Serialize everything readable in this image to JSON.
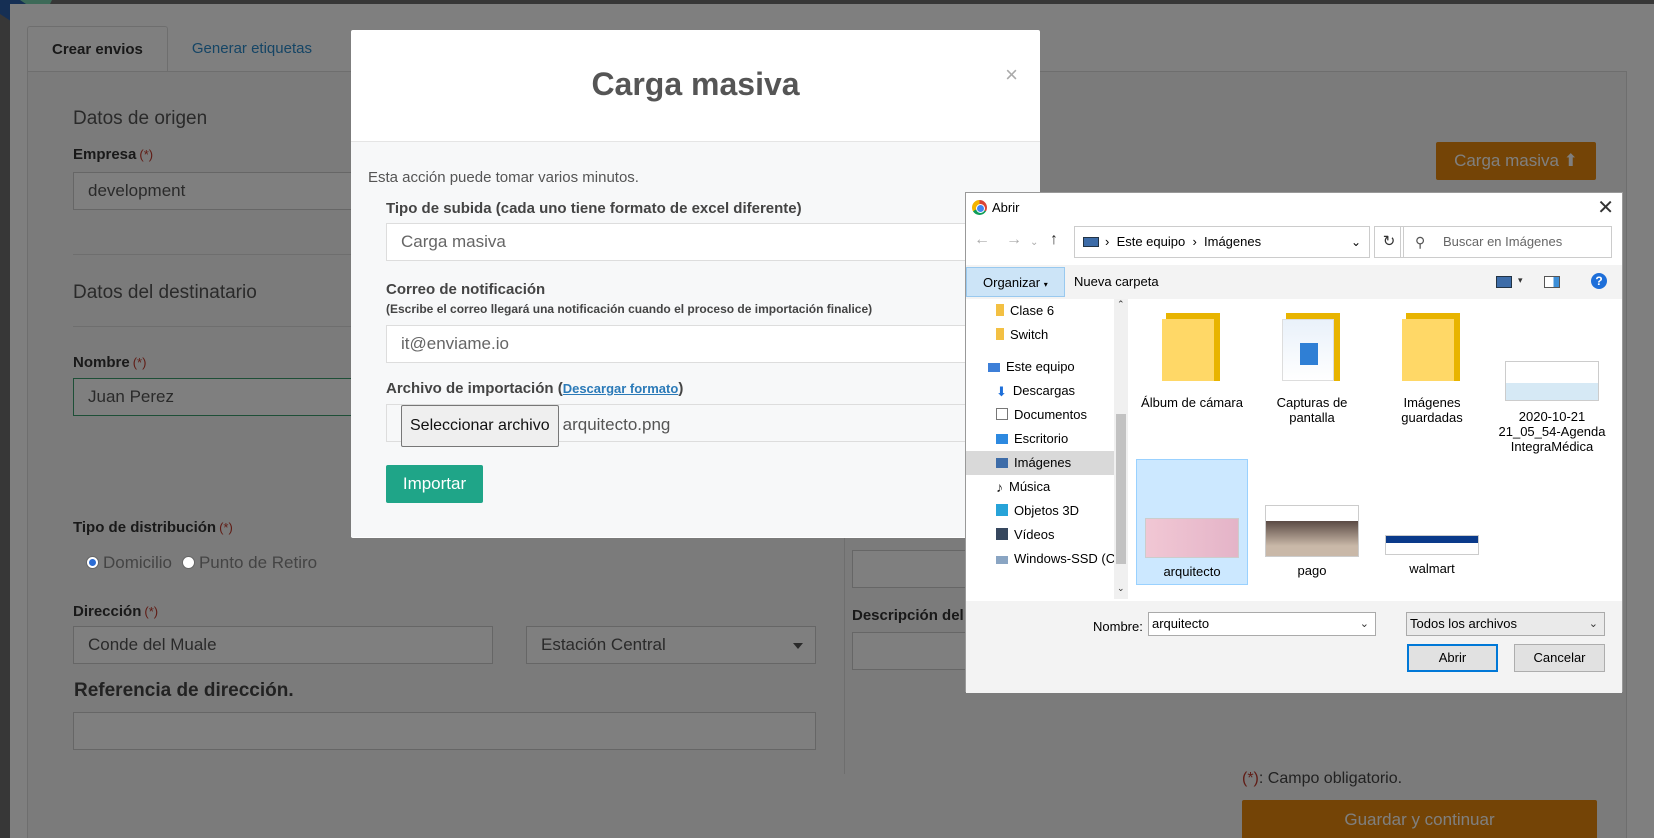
{
  "page": {
    "tabs": [
      "Crear envios",
      "Generar etiquetas"
    ],
    "origin": {
      "title": "Datos de origen",
      "empresa_label": "Empresa",
      "required_mark": "(*)",
      "empresa_value": "development"
    },
    "recipient": {
      "title": "Datos del destinatario",
      "nombre_label": "Nombre",
      "nombre_value": "Juan Perez"
    },
    "distribution": {
      "label": "Tipo de distribución",
      "options": [
        "Domicilio",
        "Punto de Retiro"
      ],
      "selected": "Domicilio"
    },
    "address": {
      "label": "Dirección",
      "value": "Conde del Muale",
      "commune": "Estación Central",
      "reference_label": "Referencia de dirección."
    },
    "description_label": "Descripción del",
    "carga_masiva_button": "Carga masiva",
    "required_note": ": Campo obligatorio.",
    "save_button": "Guardar y continuar"
  },
  "modal": {
    "title": "Carga masiva",
    "close": "×",
    "note": "Esta acción puede tomar varios minutos.",
    "upload_type_label": "Tipo de subida (cada uno tiene formato de excel diferente)",
    "upload_type_value": "Carga masiva",
    "email_label": "Correo de notificación",
    "email_help": "(Escribe el correo llegará una notificación cuando el proceso de importación finalice)",
    "email_value": "it@enviame.io",
    "file_label": "Archivo de importación",
    "file_link": "Descargar formato",
    "file_button": "Seleccionar archivo",
    "file_name": "arquitecto.png",
    "import_button": "Importar"
  },
  "dialog": {
    "title": "Abrir",
    "breadcrumb": [
      "Este equipo",
      "Imágenes"
    ],
    "search_placeholder": "Buscar en Imágenes",
    "organize": "Organizar",
    "new_folder": "Nueva carpeta",
    "tree": [
      "Clase 6",
      "Switch",
      "Este equipo",
      "Descargas",
      "Documentos",
      "Escritorio",
      "Imágenes",
      "Música",
      "Objetos 3D",
      "Vídeos",
      "Windows-SSD (C"
    ],
    "tree_selected": "Imágenes",
    "files": [
      {
        "name": "Álbum de cámara",
        "kind": "folder"
      },
      {
        "name": "Capturas de pantalla",
        "kind": "folder"
      },
      {
        "name": "Imágenes guardadas",
        "kind": "folder"
      },
      {
        "name": "2020-10-21 21_05_54-Agenda IntegraMédica",
        "kind": "image"
      },
      {
        "name": "arquitecto",
        "kind": "image"
      },
      {
        "name": "pago",
        "kind": "image"
      },
      {
        "name": "walmart",
        "kind": "image"
      }
    ],
    "selected_file": "arquitecto",
    "name_label": "Nombre:",
    "name_value": "arquitecto",
    "filter_value": "Todos los archivos",
    "open_button": "Abrir",
    "cancel_button": "Cancelar"
  },
  "colors": {
    "orange": "#e8890c",
    "green": "#1fa588",
    "selection": "#cce8ff"
  }
}
